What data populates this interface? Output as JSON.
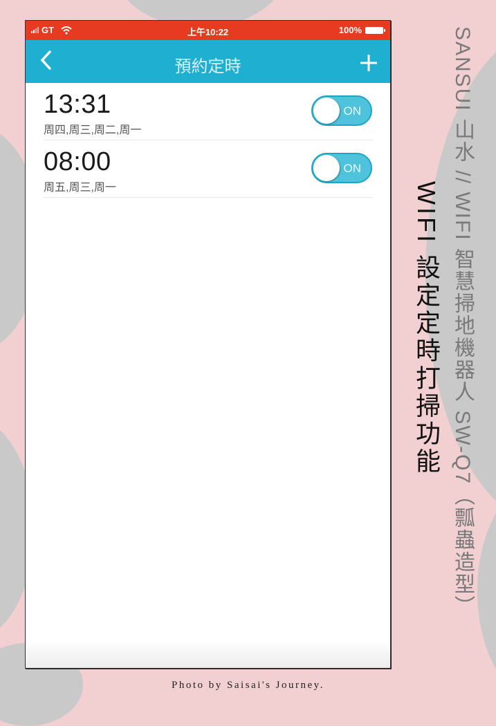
{
  "status_bar": {
    "carrier": "GT",
    "time": "上午10:22",
    "battery": "100%"
  },
  "nav": {
    "back_icon": "chevron-left-icon",
    "title": "預約定時",
    "add_icon": "plus-icon"
  },
  "schedules": [
    {
      "time": "13:31",
      "days": "周四,周三,周二,周一",
      "toggle_label": "ON",
      "enabled": true
    },
    {
      "time": "08:00",
      "days": "周五,周三,周一",
      "toggle_label": "ON",
      "enabled": true
    }
  ],
  "overlay": {
    "subtitle": "SANSUI 山水 // WIFI 智慧掃地機器人 SW-Q7（瓢蟲造型）",
    "title": "WIFI 設定定時打掃功能",
    "credit": "Photo by Saisai's Journey."
  },
  "colors": {
    "status_bar": "#e63b20",
    "nav_bar": "#1fb0d1",
    "toggle_on": "#4fc3dc",
    "background": "#f2cfd0",
    "blob": "#c9c9c9"
  }
}
